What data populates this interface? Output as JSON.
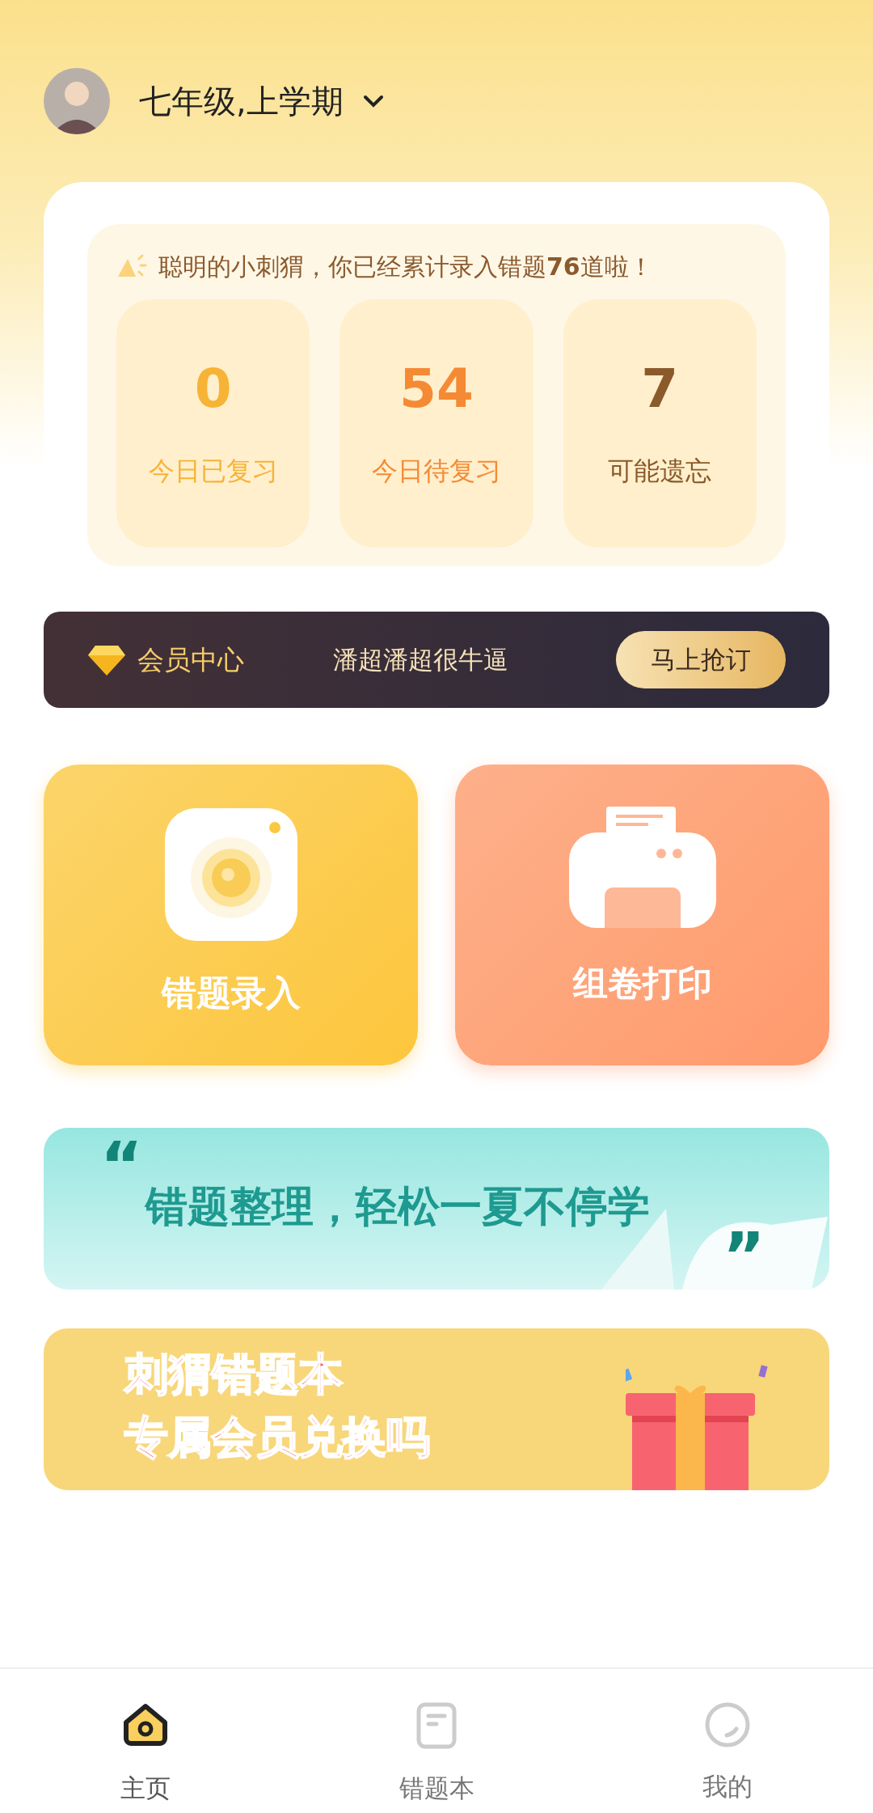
{
  "header": {
    "grade": "七年级,上学期"
  },
  "summary": {
    "message": "聪明的小刺猬，你已经累计录入错题**76**道啦！",
    "stats": [
      {
        "value": "0",
        "label": "今日已复习",
        "color": "#f7b335"
      },
      {
        "value": "54",
        "label": "今日待复习",
        "color": "#f58a34"
      },
      {
        "value": "7",
        "label": "可能遗忘",
        "color": "#8b5a2b"
      }
    ]
  },
  "membership": {
    "title": "会员中心",
    "slogan": "潘超潘超很牛逼",
    "button": "马上抢订"
  },
  "features": [
    {
      "kind": "camera",
      "label": "错题录入"
    },
    {
      "kind": "printer",
      "label": "组卷打印"
    }
  ],
  "banners": [
    {
      "kind": "quote",
      "quote_open": "“",
      "text": "错题整理，轻松一夏不停学",
      "quote_close": "”"
    },
    {
      "kind": "gift",
      "lines": [
        "刺猬错题本",
        "专属会员兑换吗"
      ]
    }
  ],
  "nav": [
    {
      "kind": "home",
      "label": "主页",
      "selected": true
    },
    {
      "kind": "book",
      "label": "错题本",
      "selected": false
    },
    {
      "kind": "profile",
      "label": "我的",
      "selected": false
    }
  ]
}
